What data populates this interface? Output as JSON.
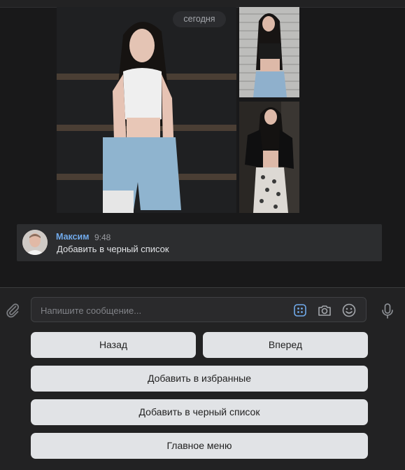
{
  "date_label": "сегодня",
  "message": {
    "author": "Максим",
    "time": "9:48",
    "text": "Добавить в черный список"
  },
  "composer": {
    "placeholder": "Напишите сообщение..."
  },
  "keyboard": {
    "back": "Назад",
    "forward": "Вперед",
    "favorites": "Добавить в избранные",
    "blacklist": "Добавить в черный список",
    "main_menu": "Главное меню"
  },
  "colors": {
    "background": "#19191a",
    "accent": "#71aaeb",
    "button": "#e1e3e6"
  }
}
